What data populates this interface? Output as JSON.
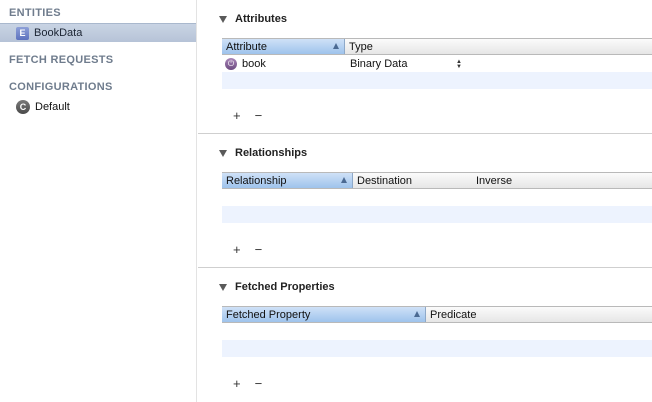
{
  "sidebar": {
    "entities_title": "ENTITIES",
    "entity": {
      "badge": "E",
      "label": "BookData"
    },
    "fetch_title": "FETCH REQUESTS",
    "configurations_title": "CONFIGURATIONS",
    "configuration": {
      "badge": "C",
      "label": "Default"
    }
  },
  "attributes": {
    "title": "Attributes",
    "col_attribute": "Attribute",
    "col_type": "Type",
    "rows": [
      {
        "name": "book",
        "type": "Binary Data",
        "icon": "attribute-icon"
      }
    ],
    "add": "+",
    "remove": "−"
  },
  "relationships": {
    "title": "Relationships",
    "col_relationship": "Relationship",
    "col_destination": "Destination",
    "col_inverse": "Inverse",
    "add": "+",
    "remove": "−"
  },
  "fetched": {
    "title": "Fetched Properties",
    "col_property": "Fetched Property",
    "col_predicate": "Predicate",
    "add": "+",
    "remove": "−"
  },
  "colors": {
    "sidebar_section": "#6f7c8d",
    "selected_row": "#b6c3d7",
    "sorted_header": "#9ec3ec",
    "alt_row": "#edf3fe"
  }
}
